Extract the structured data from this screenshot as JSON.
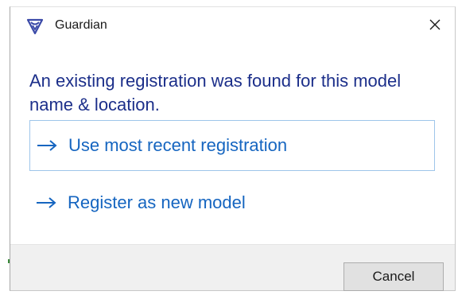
{
  "window": {
    "title": "Guardian",
    "icon": "guardian-shield-icon",
    "close_icon": "close-icon"
  },
  "message": "An existing registration was found for this model name & location.",
  "options": [
    {
      "label": "Use most recent registration",
      "icon": "arrow-right-icon",
      "selected": true
    },
    {
      "label": "Register as new model",
      "icon": "arrow-right-icon",
      "selected": false
    }
  ],
  "footer": {
    "cancel_label": "Cancel"
  },
  "colors": {
    "message_text": "#1c2f8a",
    "link_text": "#1565c0",
    "selected_border": "#9ec5ea",
    "footer_bg": "#f0f0f0",
    "icon_brand": "#3b4aa8"
  }
}
